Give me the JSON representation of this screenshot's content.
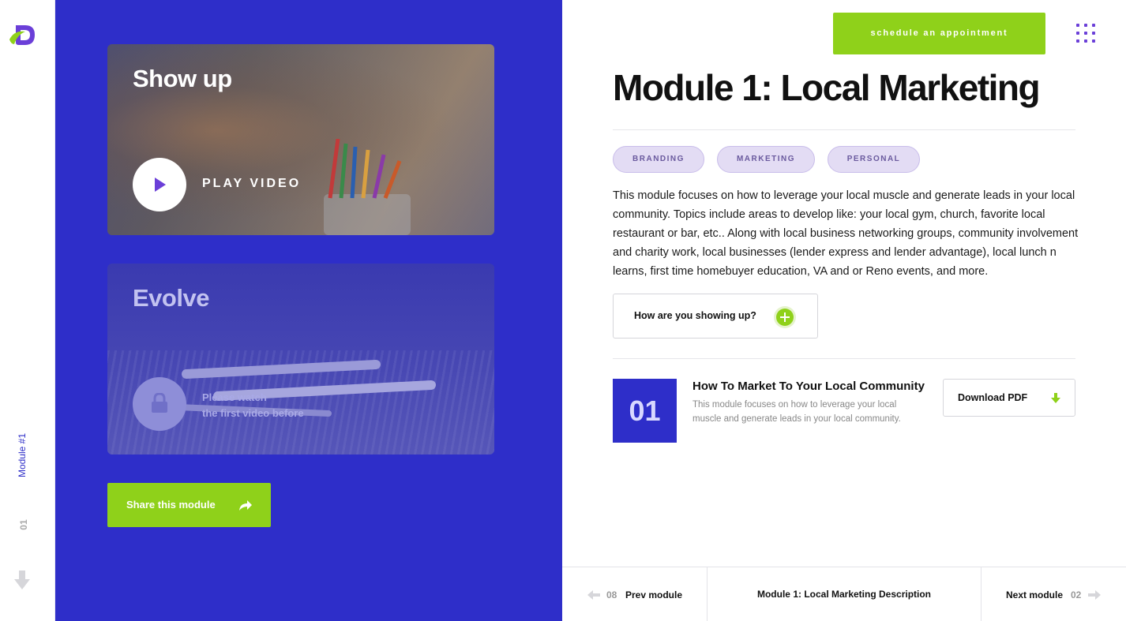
{
  "rail": {
    "logo_icon": "brand-logo",
    "module_label": "Module #1",
    "module_number": "01",
    "down_icon": "arrow-down-icon"
  },
  "cards": {
    "show_up": {
      "title": "Show up",
      "play_label": "PLAY VIDEO",
      "icon": "play-icon"
    },
    "evolve": {
      "title": "Evolve",
      "lock_text_line1": "Please watch",
      "lock_text_line2": "the first video before",
      "icon": "lock-icon"
    }
  },
  "share": {
    "label": "Share this module",
    "icon": "share-arrow-icon"
  },
  "header": {
    "appointment_label": "schedule an appointment",
    "menu_icon": "grid-menu-icon"
  },
  "module": {
    "title": "Module 1: Local Marketing",
    "tags": [
      "BRANDING",
      "MARKETING",
      "PERSONAL"
    ],
    "description": "This module focuses on how to leverage your local muscle and generate leads in your local community. Topics include areas to develop like: your local gym, church, favorite local restaurant or bar, etc.. Along with local business networking groups, community involvement and charity work, local businesses (lender express and lender advantage), local lunch n learns, first time homebuyer education, VA and or Reno events, and more.",
    "accordion_label": "How are you showing up?",
    "lesson": {
      "number": "01",
      "title": "How To Market To Your Local Community",
      "description": "This module focuses on how to leverage your local muscle and generate leads in your local community.",
      "pdf_label": "Download PDF"
    }
  },
  "footer": {
    "prev_number": "08",
    "prev_label": "Prev module",
    "current_label": "Module 1: Local Marketing Description",
    "next_label": "Next module",
    "next_number": "02"
  },
  "colors": {
    "accent_blue": "#2e2ec9",
    "accent_green": "#8fd11a",
    "accent_purple": "#6b3fd8",
    "tag_bg": "#e3dcf4"
  }
}
